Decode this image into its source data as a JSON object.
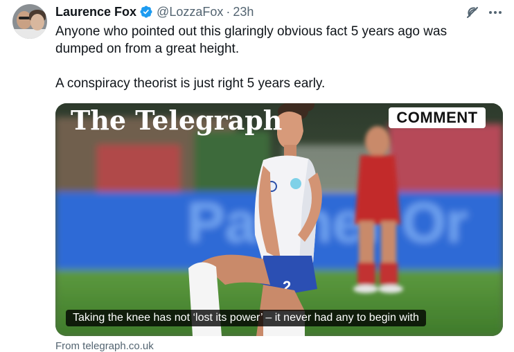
{
  "author": {
    "name": "Laurence Fox",
    "handle": "@LozzaFox",
    "separator": "·",
    "time": "23h",
    "verified": true,
    "verified_color": "#1d9bf0"
  },
  "post": {
    "line1": "Anyone who pointed out this glaringly obvious fact 5 years ago was",
    "line2": "dumped on from a great height.",
    "line3": "A conspiracy theorist is just right 5 years early."
  },
  "card": {
    "publication": "The Telegraph",
    "badge": "COMMENT",
    "caption": "Taking the knee has not ‘lost its power’ – it never had any to begin with",
    "source": "From telegraph.co.uk",
    "jersey_number": "2"
  },
  "icons": {
    "grok": "grok-icon",
    "more": "more-icon",
    "verified": "verified-badge-icon"
  },
  "colors": {
    "text": "#0f1419",
    "secondary": "#536471",
    "accent": "#1d9bf0"
  }
}
